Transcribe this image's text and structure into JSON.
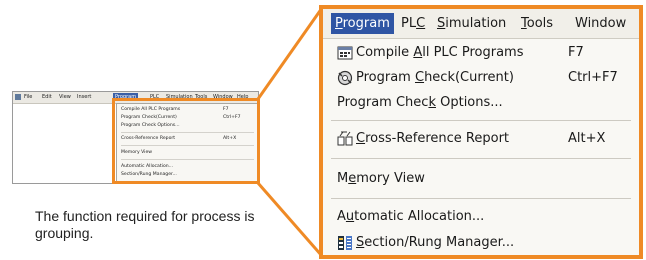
{
  "thumbnail": {
    "menubar": [
      "File",
      "Edit",
      "View",
      "Insert",
      "Program",
      "PLC",
      "Simulation",
      "Tools",
      "Window",
      "Help"
    ],
    "menu_items": [
      {
        "label": "Compile All PLC Programs",
        "shortcut": "F7"
      },
      {
        "label": "Program Check(Current)",
        "shortcut": "Ctrl+F7"
      },
      {
        "label": "Program Check Options...",
        "shortcut": ""
      },
      {
        "label": "Cross-Reference Report",
        "shortcut": "Alt+X"
      },
      {
        "label": "Memory View",
        "shortcut": ""
      },
      {
        "label": "Automatic Allocation...",
        "shortcut": ""
      },
      {
        "label": "Section/Rung Manager...",
        "shortcut": ""
      }
    ]
  },
  "zoom": {
    "menubar": {
      "program": {
        "u": "P",
        "rest": "rogram"
      },
      "plc": {
        "pre": "PL",
        "u": "C"
      },
      "simulation": {
        "u": "S",
        "rest": "imulation"
      },
      "tools": {
        "u": "T",
        "rest": "ools"
      },
      "window": "Window"
    },
    "items": {
      "compile": {
        "pre": "Compile ",
        "u": "A",
        "post": "ll PLC Programs",
        "shortcut": "F7",
        "icon": "compile-icon"
      },
      "check": {
        "pre": "Program ",
        "u": "C",
        "post": "heck(Current)",
        "shortcut": "Ctrl+F7",
        "icon": "program-check-icon"
      },
      "check_options": {
        "pre": "Program Chec",
        "u": "k",
        "post": " Options...",
        "shortcut": ""
      },
      "cross_ref": {
        "pre": "",
        "u": "C",
        "post": "ross-Reference Report",
        "shortcut": "Alt+X",
        "icon": "cross-reference-icon"
      },
      "memory": {
        "pre": "M",
        "u": "e",
        "post": "mory View",
        "shortcut": ""
      },
      "auto_alloc": {
        "pre": "A",
        "u": "u",
        "post": "tomatic Allocation...",
        "shortcut": ""
      },
      "section": {
        "pre": "",
        "u": "S",
        "post": "ection/Rung Manager...",
        "shortcut": "",
        "icon": "section-manager-icon"
      }
    }
  },
  "caption": "The function required for process is grouping.",
  "colors": {
    "highlight": "#ef8a25",
    "menu_active": "#2f55a4"
  }
}
